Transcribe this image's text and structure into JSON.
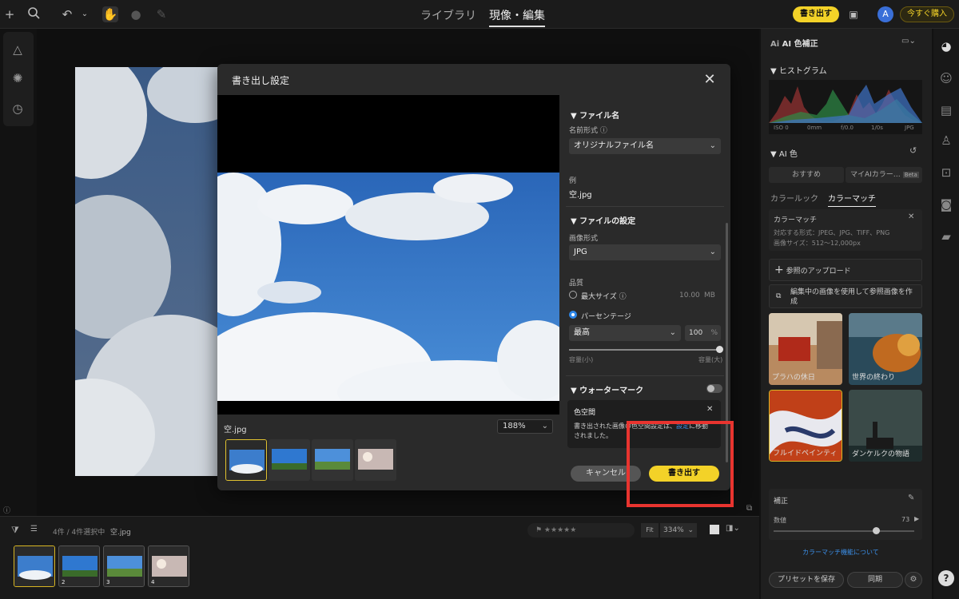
{
  "topbar": {
    "tabs": [
      "ライブラリ",
      "現像・編集"
    ],
    "active_tab": 1,
    "export_label": "書き出す",
    "avatar_letter": "A",
    "buy_label": "今すぐ購入"
  },
  "dialog": {
    "title": "書き出し設定",
    "preview_filename": "空.jpg",
    "zoom": "188%",
    "file_name_section": "ファイル名",
    "name_format_label": "名前形式",
    "name_format_value": "オリジナルファイル名",
    "example_label": "例",
    "example_value": "空.jpg",
    "file_settings_section": "ファイルの設定",
    "image_format_label": "画像形式",
    "image_format_value": "JPG",
    "quality_label": "品質",
    "max_size_label": "最大サイズ",
    "max_size_value": "10.00",
    "max_size_unit": "MB",
    "percentage_label": "パーセンテージ",
    "quality_preset": "最高",
    "quality_value": "100",
    "quality_unit": "%",
    "slider_min_label": "容量(小)",
    "slider_max_label": "容量(大)",
    "watermark_section": "ウォーターマーク",
    "colorspace_title": "色空間",
    "colorspace_text_1": "書き出された画像の色空間設定は、",
    "colorspace_link": "設定",
    "colorspace_text_2": "に移動",
    "colorspace_text_3": "されました。",
    "cancel_label": "キャンセル",
    "export_label": "書き出す"
  },
  "right_panel": {
    "header": "AI 色補正",
    "ai_label": "Ai",
    "histogram_section": "ヒストグラム",
    "hist_meta": [
      "ISO 0",
      "0mm",
      "f/0.0",
      "1/0s",
      "JPG"
    ],
    "ai_color_section": "AI 色",
    "sub_tabs": [
      "おすすめ",
      "マイAIカラー…",
      "Beta"
    ],
    "tabs": [
      "カラールック",
      "カラーマッチ"
    ],
    "colormatch_title": "カラーマッチ",
    "supported_formats": "対応する形式：JPEG、JPG、TIFF、PNG",
    "image_size": "画像サイズ：512〜12,000px",
    "upload_reference": "参照のアップロード",
    "use_current_image": "編集中の画像を使用して参照画像を作成",
    "looks": [
      "プラハの休日",
      "世界の終わり",
      "フルイドペインティ",
      "ダンケルクの物語"
    ],
    "correction_section": "補正",
    "amount_label": "数値",
    "amount_value": "73",
    "amount_level": 0.73,
    "about_link": "カラーマッチ機能について",
    "save_preset": "プリセットを保存",
    "sync_label": "同期"
  },
  "bottom_bar": {
    "count_text": "4件 / 4件選択中",
    "filename": "空.jpg",
    "fit_label": "Fit",
    "zoom": "334%",
    "thumb_numbers": [
      "",
      "2",
      "3",
      "4"
    ]
  },
  "colors": {
    "accent_yellow": "#f3d228",
    "highlight_red": "#e8342f",
    "link_blue": "#3b8fe8"
  }
}
